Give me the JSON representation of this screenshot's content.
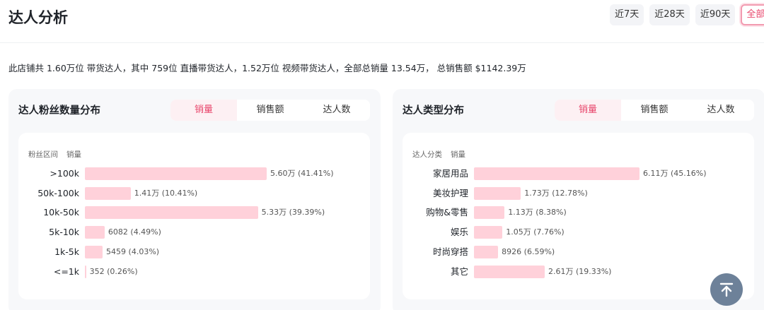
{
  "page": {
    "title": "达人分析"
  },
  "time_range": {
    "options": [
      "近7天",
      "近28天",
      "近90天",
      "全部"
    ],
    "selected": "全部"
  },
  "summary": "此店铺共 1.60万位 带货达人，其中 759位 直播带货达人，1.52万位 视频带货达人，全部总销量 13.54万， 总销售额 $1142.39万",
  "panels": {
    "fans": {
      "title": "达人粉丝数量分布",
      "tabs": [
        "销量",
        "销售额",
        "达人数"
      ],
      "active_tab": "销量",
      "col_label": "粉丝区间",
      "col_value": "销量"
    },
    "types": {
      "title": "达人类型分布",
      "tabs": [
        "销量",
        "销售额",
        "达人数"
      ],
      "active_tab": "销量",
      "col_label": "达人分类",
      "col_value": "销量"
    }
  },
  "chart_data": [
    {
      "type": "bar",
      "orientation": "horizontal",
      "title": "达人粉丝数量分布",
      "xlabel": "销量",
      "ylabel": "粉丝区间",
      "categories": [
        ">100k",
        "50k-100k",
        "10k-50k",
        "5k-10k",
        "1k-5k",
        "<=1k"
      ],
      "values": [
        56000,
        14100,
        53300,
        6082,
        5459,
        352
      ],
      "labels": [
        "5.60万 (41.41%)",
        "1.41万 (10.41%)",
        "5.33万 (39.39%)",
        "6082 (4.49%)",
        "5459 (4.03%)",
        "352 (0.26%)"
      ],
      "xlim": [
        0,
        56000
      ]
    },
    {
      "type": "bar",
      "orientation": "horizontal",
      "title": "达人类型分布",
      "xlabel": "销量",
      "ylabel": "达人分类",
      "categories": [
        "家居用品",
        "美妆护理",
        "购物&零售",
        "娱乐",
        "时尚穿搭",
        "其它"
      ],
      "values": [
        61100,
        17300,
        11300,
        10500,
        8926,
        26100
      ],
      "labels": [
        "6.11万 (45.16%)",
        "1.73万 (12.78%)",
        "1.13万 (8.38%)",
        "1.05万 (7.76%)",
        "8926 (6.59%)",
        "2.61万 (19.33%)"
      ],
      "xlim": [
        0,
        61100
      ]
    }
  ],
  "colors": {
    "accent": "#e8456b",
    "bar": "#ffd1da",
    "panel_bg": "#f7f8fa",
    "scroll_button": "#6d8199"
  },
  "icons": {
    "scroll_top": "arrow-up-to-line-icon"
  }
}
